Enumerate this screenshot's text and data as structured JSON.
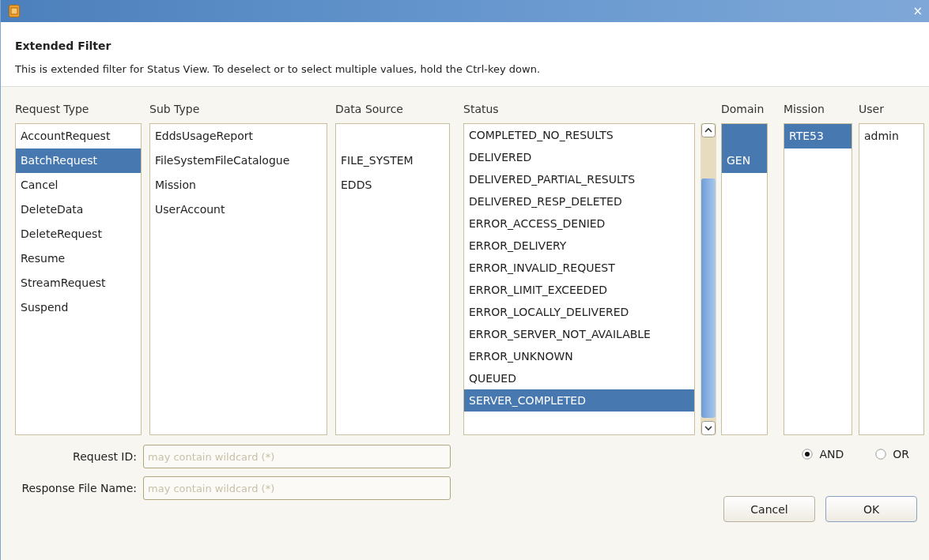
{
  "window": {
    "close": "×"
  },
  "header": {
    "title": "Extended Filter",
    "description": "This is extended filter for Status View. To deselect or to select multiple values, hold the Ctrl-key down."
  },
  "columns": [
    {
      "kind": "list",
      "header": "Request Type",
      "items": [
        {
          "label": "AccountRequest",
          "selected": false
        },
        {
          "label": "BatchRequest",
          "selected": true
        },
        {
          "label": "Cancel",
          "selected": false
        },
        {
          "label": "DeleteData",
          "selected": false
        },
        {
          "label": "DeleteRequest",
          "selected": false
        },
        {
          "label": "Resume",
          "selected": false
        },
        {
          "label": "StreamRequest",
          "selected": false
        },
        {
          "label": "Suspend",
          "selected": false
        }
      ]
    },
    {
      "kind": "list",
      "header": "Sub Type",
      "items": [
        {
          "label": "EddsUsageReport",
          "selected": false
        },
        {
          "label": "FileSystemFileCatalogue",
          "selected": false
        },
        {
          "label": "Mission",
          "selected": false
        },
        {
          "label": "UserAccount",
          "selected": false
        }
      ]
    },
    {
      "kind": "list",
      "header": "Data Source",
      "items": [
        {
          "selected": false
        },
        {
          "label": "FILE_SYSTEM",
          "selected": false
        },
        {
          "label": "EDDS",
          "selected": false
        }
      ]
    },
    {
      "kind": "scroll-list",
      "header": "Status",
      "items": [
        {
          "label": "COMPLETED_NO_RESULTS",
          "selected": false
        },
        {
          "label": "DELIVERED",
          "selected": false
        },
        {
          "label": "DELIVERED_PARTIAL_RESULTS",
          "selected": false
        },
        {
          "label": "DELIVERED_RESP_DELETED",
          "selected": false
        },
        {
          "label": "ERROR_ACCESS_DENIED",
          "selected": false
        },
        {
          "label": "ERROR_DELIVERY",
          "selected": false
        },
        {
          "label": "ERROR_INVALID_REQUEST",
          "selected": false
        },
        {
          "label": "ERROR_LIMIT_EXCEEDED",
          "selected": false
        },
        {
          "label": "ERROR_LOCALLY_DELIVERED",
          "selected": false
        },
        {
          "label": "ERROR_SERVER_NOT_AVAILABLE",
          "selected": false
        },
        {
          "label": "ERROR_UNKNOWN",
          "selected": false
        },
        {
          "label": "QUEUED",
          "selected": false
        },
        {
          "label": "SERVER_COMPLETED",
          "selected": true
        }
      ]
    },
    {
      "kind": "list",
      "header": "Domain",
      "items": [
        {
          "selected": true
        },
        {
          "label": "GEN",
          "selected": true
        }
      ]
    },
    {
      "kind": "list",
      "header": "Mission",
      "items": [
        {
          "label": "RTE53",
          "selected": true
        }
      ]
    },
    {
      "kind": "list",
      "header": "User",
      "items": [
        {
          "label": "admin",
          "selected": false
        }
      ]
    }
  ],
  "fields": [
    {
      "label": "Request ID:",
      "placeholder": "may contain wildcard (*)"
    },
    {
      "label": "Response File Name:",
      "placeholder": "may contain wildcard (*)"
    }
  ],
  "logic": [
    {
      "label": "AND",
      "selected": true
    },
    {
      "label": "OR",
      "selected": false
    }
  ],
  "buttons": [
    "Cancel",
    "OK"
  ]
}
